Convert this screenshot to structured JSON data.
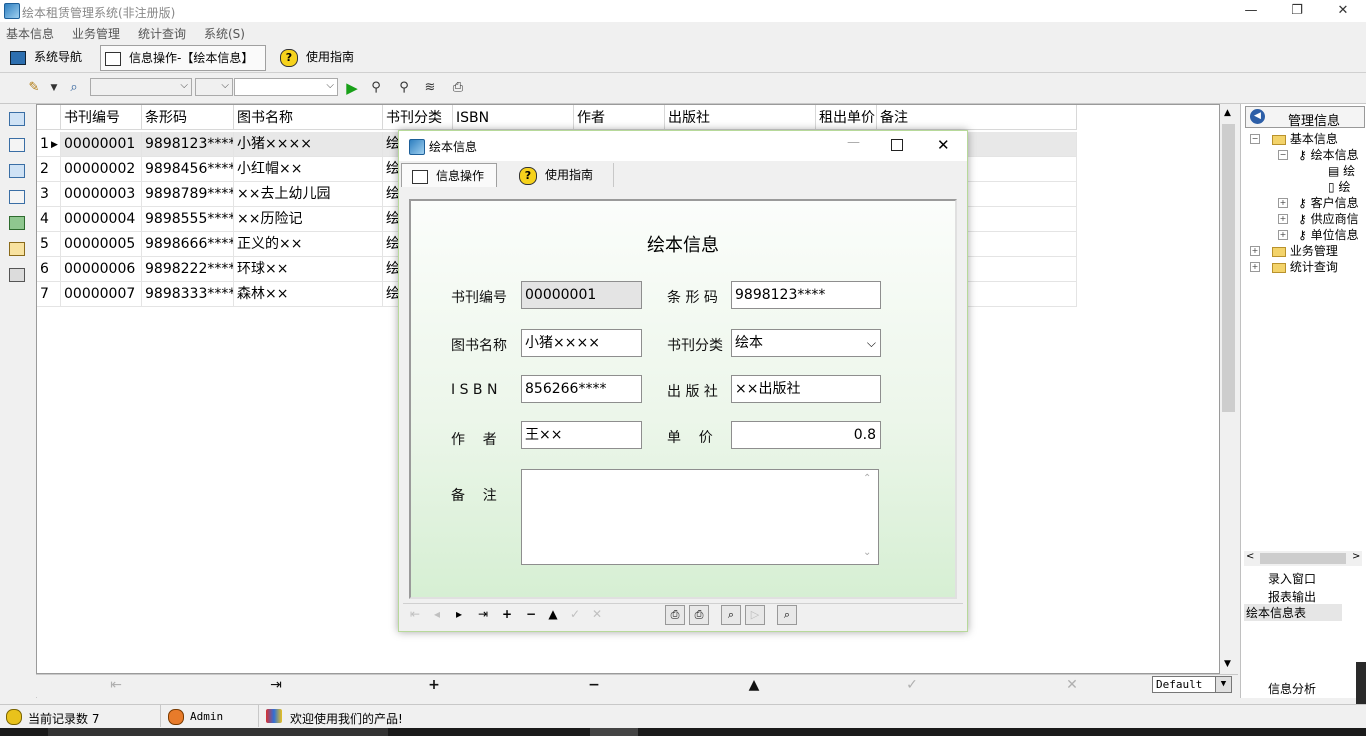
{
  "window": {
    "title": "绘本租赁管理系统(非注册版)"
  },
  "menu": [
    "基本信息",
    "业务管理",
    "统计查询",
    "系统(S)"
  ],
  "tabs": {
    "nav": "系统导航",
    "info": "信息操作-【绘本信息】",
    "guide": "使用指南"
  },
  "grid": {
    "columns": [
      "书刊编号",
      "条形码",
      "图书名称",
      "书刊分类",
      "ISBN",
      "作者",
      "出版社",
      "租出单价",
      "备注"
    ],
    "rows": [
      {
        "n": "1",
        "id": "00000001",
        "barcode": "9898123****",
        "name": "小猪××××",
        "cat": "绘"
      },
      {
        "n": "2",
        "id": "00000002",
        "barcode": "9898456****",
        "name": "小红帽××",
        "cat": "绘"
      },
      {
        "n": "3",
        "id": "00000003",
        "barcode": "9898789****",
        "name": "××去上幼儿园",
        "cat": "绘"
      },
      {
        "n": "4",
        "id": "00000004",
        "barcode": "9898555****",
        "name": "××历险记",
        "cat": "绘"
      },
      {
        "n": "5",
        "id": "00000005",
        "barcode": "9898666****",
        "name": "正义的××",
        "cat": "绘"
      },
      {
        "n": "6",
        "id": "00000006",
        "barcode": "9898222****",
        "name": "环球××",
        "cat": "绘"
      },
      {
        "n": "7",
        "id": "00000007",
        "barcode": "9898333****",
        "name": "森林××",
        "cat": "绘"
      }
    ]
  },
  "navigator": {
    "style": "Default"
  },
  "rightPanel": {
    "header": "管理信息",
    "tree": [
      "基本信息",
      "绘本信息",
      "绘",
      "绘",
      "客户信息",
      "供应商信",
      "单位信息",
      "业务管理",
      "统计查询"
    ],
    "list": [
      "录入窗口",
      "报表输出",
      "绘本信息表"
    ],
    "footer": "信息分析"
  },
  "status": {
    "records": "当前记录数 7",
    "user": "Admin",
    "welcome": "欢迎使用我们的产品!"
  },
  "dialog": {
    "title": "绘本信息",
    "tabs": [
      "信息操作",
      "使用指南"
    ],
    "heading": "绘本信息",
    "labels": {
      "id": "书刊编号",
      "barcode": "条 形 码",
      "name": "图书名称",
      "cat": "书刊分类",
      "isbn": "I S B N",
      "publisher": "出 版 社",
      "author": "作    者",
      "price": "单    价",
      "note": "备    注"
    },
    "values": {
      "id": "00000001",
      "barcode": "9898123****",
      "name": "小猪××××",
      "cat": "绘本",
      "isbn": "856266****",
      "publisher": "××出版社",
      "author": "王××",
      "price": "0.8",
      "note": ""
    }
  }
}
